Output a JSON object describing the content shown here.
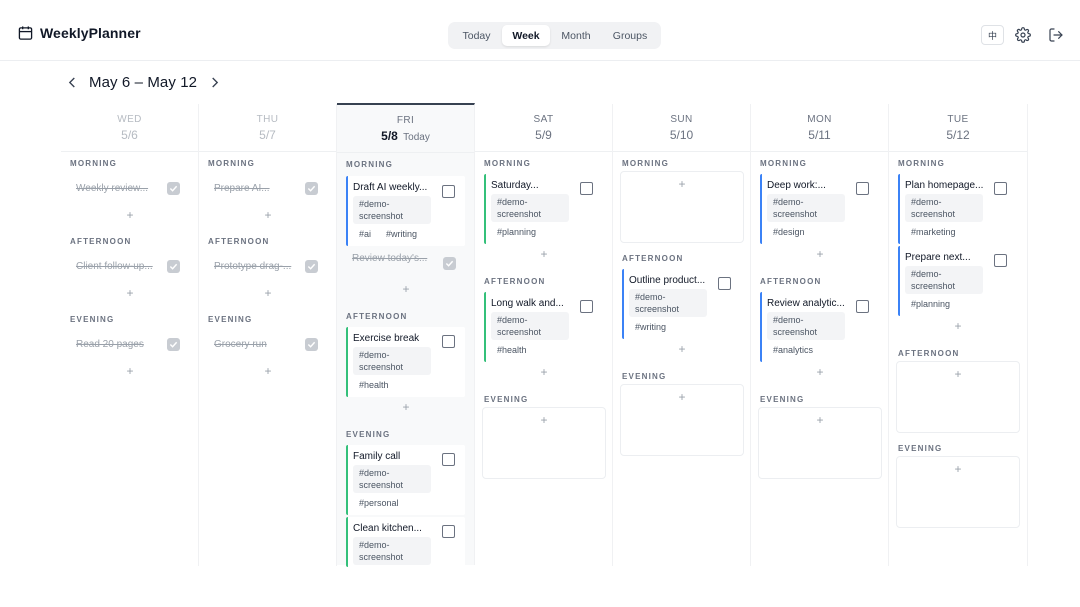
{
  "app": {
    "title": "WeeklyPlanner"
  },
  "view_tabs": [
    {
      "label": "Today",
      "active": false
    },
    {
      "label": "Week",
      "active": true
    },
    {
      "label": "Month",
      "active": false
    },
    {
      "label": "Groups",
      "active": false
    }
  ],
  "lang_button": "中",
  "week_range": "May 6 – May 12",
  "slot_labels": {
    "morning": "MORNING",
    "afternoon": "AFTERNOON",
    "evening": "EVENING"
  },
  "colors": {
    "accent_blue": "#3b82f6",
    "accent_green": "#34c07a",
    "today_border": "#374151"
  },
  "days": [
    {
      "dow": "WED",
      "date": "5/6",
      "past": true,
      "morning": [
        {
          "title": "Weekly review...",
          "done": true
        }
      ],
      "afternoon": [
        {
          "title": "Client follow-up...",
          "done": true
        }
      ],
      "evening": [
        {
          "title": "Read 20 pages",
          "done": true
        }
      ]
    },
    {
      "dow": "THU",
      "date": "5/7",
      "past": true,
      "morning": [
        {
          "title": "Prepare AI...",
          "done": true
        }
      ],
      "afternoon": [
        {
          "title": "Prototype drag-...",
          "done": true
        }
      ],
      "evening": [
        {
          "title": "Grocery run",
          "done": true
        }
      ]
    },
    {
      "dow": "FRI",
      "date": "5/8",
      "today_label": "Today",
      "today": true,
      "morning": [
        {
          "title": "Draft AI weekly...",
          "tags": [
            "#demo-screenshot",
            "#ai",
            "#writing"
          ],
          "color": "blue",
          "done": false
        },
        {
          "title": "Review today's...",
          "done": true
        }
      ],
      "afternoon": [
        {
          "title": "Exercise break",
          "tags": [
            "#demo-screenshot",
            "#health"
          ],
          "color": "green",
          "done": false
        }
      ],
      "evening": [
        {
          "title": "Family call",
          "tags": [
            "#demo-screenshot",
            "#personal"
          ],
          "color": "green",
          "done": false
        },
        {
          "title": "Clean kitchen...",
          "tags": [
            "#demo-screenshot"
          ],
          "color": "green",
          "done": false
        }
      ]
    },
    {
      "dow": "SAT",
      "date": "5/9",
      "morning": [
        {
          "title": "Saturday...",
          "tags": [
            "#demo-screenshot",
            "#planning"
          ],
          "color": "green",
          "done": false
        }
      ],
      "afternoon": [
        {
          "title": "Long walk and...",
          "tags": [
            "#demo-screenshot",
            "#health"
          ],
          "color": "green",
          "done": false
        }
      ],
      "evening": []
    },
    {
      "dow": "SUN",
      "date": "5/10",
      "morning": [],
      "afternoon": [
        {
          "title": "Outline product...",
          "tags": [
            "#demo-screenshot",
            "#writing"
          ],
          "color": "blue",
          "done": false
        }
      ],
      "evening": []
    },
    {
      "dow": "MON",
      "date": "5/11",
      "morning": [
        {
          "title": "Deep work:...",
          "tags": [
            "#demo-screenshot",
            "#design"
          ],
          "color": "blue",
          "done": false
        }
      ],
      "afternoon": [
        {
          "title": "Review analytic...",
          "tags": [
            "#demo-screenshot",
            "#analytics"
          ],
          "color": "blue",
          "done": false
        }
      ],
      "evening": []
    },
    {
      "dow": "TUE",
      "date": "5/12",
      "morning": [
        {
          "title": "Plan homepage...",
          "tags": [
            "#demo-screenshot",
            "#marketing"
          ],
          "color": "blue",
          "done": false
        },
        {
          "title": "Prepare next...",
          "tags": [
            "#demo-screenshot",
            "#planning"
          ],
          "color": "blue",
          "done": false
        }
      ],
      "afternoon": [],
      "evening": []
    }
  ]
}
